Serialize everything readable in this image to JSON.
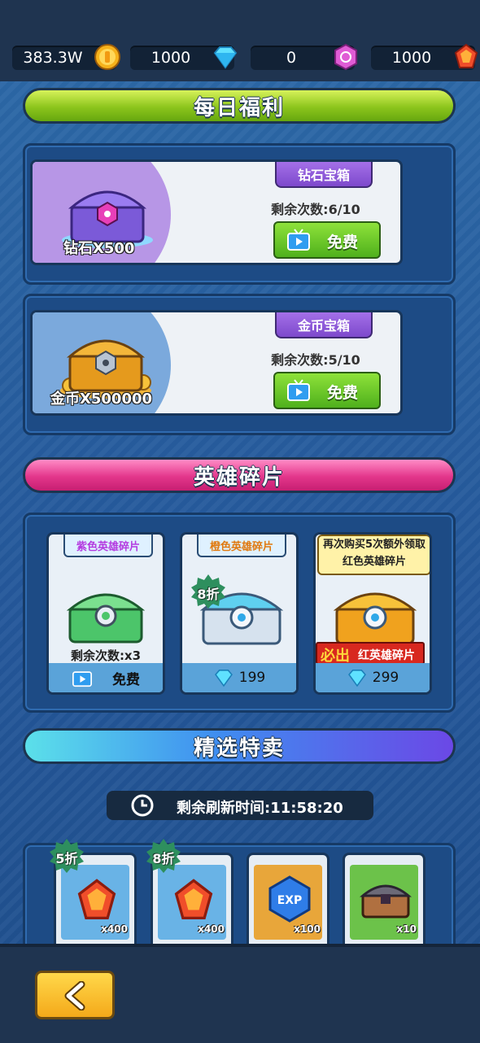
{
  "resources": [
    {
      "value": "383.3W",
      "icon": "gold-coin-icon"
    },
    {
      "value": "1000",
      "icon": "diamond-icon"
    },
    {
      "value": "0",
      "icon": "purple-gem-icon"
    },
    {
      "value": "1000",
      "icon": "red-gem-icon"
    }
  ],
  "daily": {
    "banner": "每日福利",
    "diamond_chest": {
      "title": "钻石宝箱",
      "remain": "剩余次数:6/10",
      "button": "免费",
      "amount": "钻石X500"
    },
    "gold_chest": {
      "title": "金币宝箱",
      "remain": "剩余次数:5/10",
      "button": "免费",
      "amount": "金币X500000"
    }
  },
  "hero": {
    "banner": "英雄碎片",
    "cards": [
      {
        "tag": "紫色英雄碎片",
        "remain": "剩余次数:x3",
        "button": "免费"
      },
      {
        "tag": "橙色英雄碎片",
        "discount": "8折",
        "price": "199"
      },
      {
        "bubble": "再次购买5次额外领取红色英雄碎片",
        "must": "必出",
        "must_label": "红英雄碎片",
        "price": "299"
      }
    ]
  },
  "featured": {
    "banner": "精选特卖",
    "timer": "剩余刷新时间:11:58:20",
    "deals": [
      {
        "discount": "5折",
        "qty": "x400",
        "icon": "red-gem-icon"
      },
      {
        "discount": "8折",
        "qty": "x400",
        "icon": "red-gem-icon"
      },
      {
        "qty": "x100",
        "icon": "exp-gem-icon",
        "label": "EXP"
      },
      {
        "qty": "x10",
        "icon": "chest-icon"
      }
    ]
  },
  "colors": {
    "accent_green": "#8cc51c",
    "accent_pink": "#e3368b",
    "accent_blue": "#3f8df0",
    "button_yellow": "#f4a91a"
  }
}
